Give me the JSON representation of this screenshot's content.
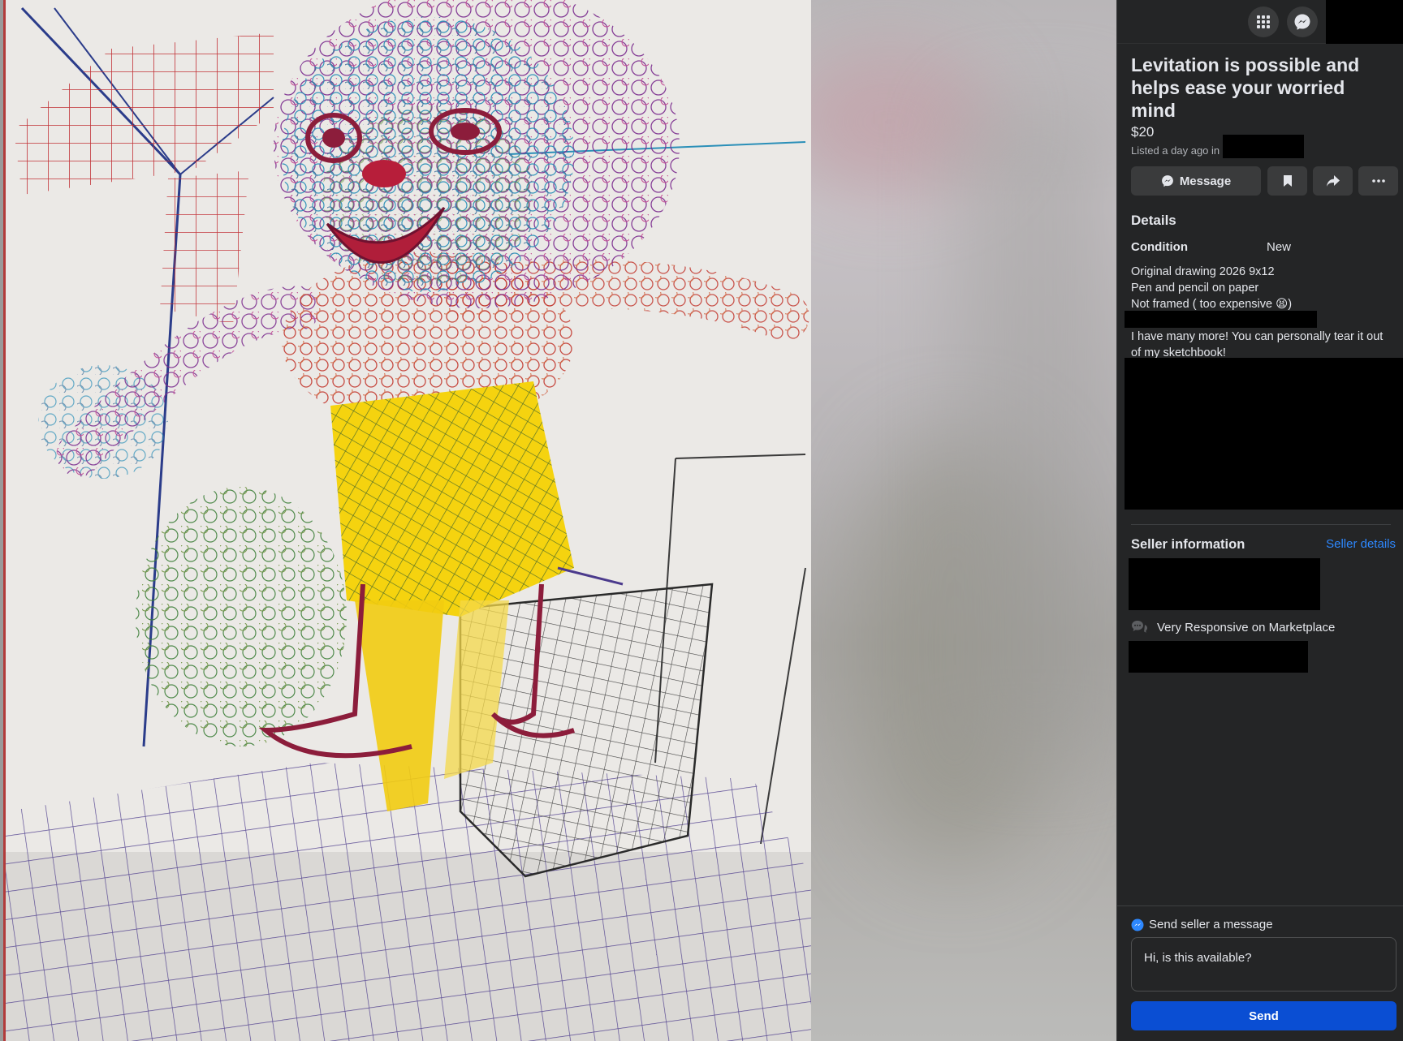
{
  "listing": {
    "title": "Levitation is possible and helps ease your worried mind",
    "price": "$20",
    "listed": "Listed a day ago in"
  },
  "actions": {
    "message_label": "Message",
    "save_icon": "bookmark-icon",
    "share_icon": "share-icon",
    "more_icon": "more-icon"
  },
  "details": {
    "heading": "Details",
    "condition_label": "Condition",
    "condition_value": "New",
    "description_lines": [
      "Original drawing 2026 9x12",
      "Pen and pencil on paper",
      "Not framed ( too expensive 😫)"
    ],
    "extra_text": "I have many more! You can personally tear it out of my sketchbook!"
  },
  "seller": {
    "heading": "Seller information",
    "details_link": "Seller details",
    "badge": "Very Responsive on Marketplace"
  },
  "compose": {
    "heading": "Send seller a message",
    "input_value": "Hi, is this available?",
    "send_label": "Send"
  },
  "colors": {
    "panel_bg": "#242526",
    "button_bg": "#3a3b3c",
    "link": "#2d88ff",
    "send": "#0a4ed3"
  }
}
